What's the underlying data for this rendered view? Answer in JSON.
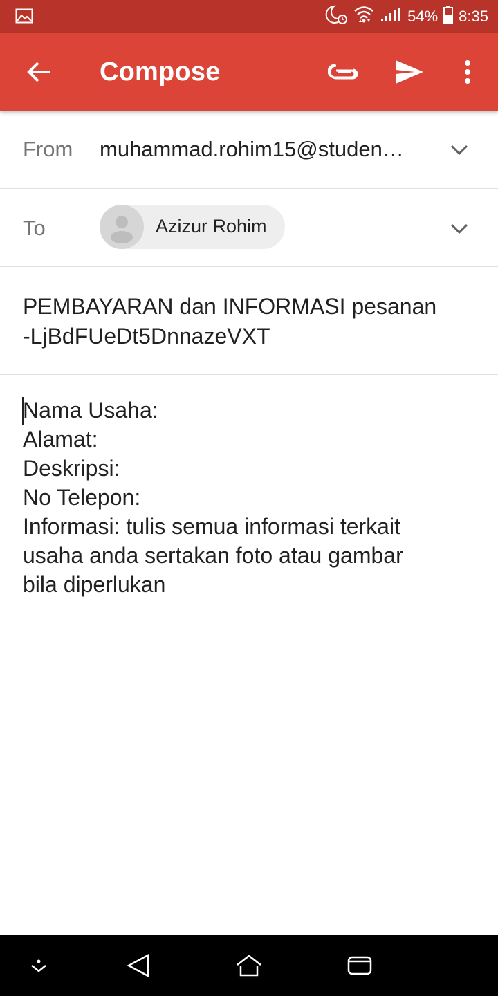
{
  "status_bar": {
    "battery": "54%",
    "time": "8:35",
    "icons": [
      "gallery-icon",
      "moon-alarm-icon",
      "wifi-icon",
      "signal-icon",
      "battery-icon"
    ]
  },
  "app_bar": {
    "title": "Compose",
    "icons": [
      "back-arrow-icon",
      "attachment-icon",
      "send-icon",
      "more-vert-icon"
    ],
    "color": "#db4437"
  },
  "compose": {
    "from_label": "From",
    "from_value": "muhammad.rohim15@studen…",
    "to_label": "To",
    "to_recipient": "Azizur Rohim",
    "subject_line1": "PEMBAYARAN dan INFORMASI pesanan",
    "subject_line2": "-LjBdFUeDt5DnnazeVXT",
    "body_lines": [
      "Nama Usaha:",
      "Alamat:",
      "Deskripsi:",
      "No Telepon:",
      "Informasi: tulis semua informasi terkait",
      "usaha anda sertakan foto atau gambar",
      "bila diperlukan"
    ]
  },
  "nav_bar": {
    "icons": [
      "hide-keyboard-icon",
      "nav-back-icon",
      "home-icon",
      "recents-icon"
    ]
  }
}
